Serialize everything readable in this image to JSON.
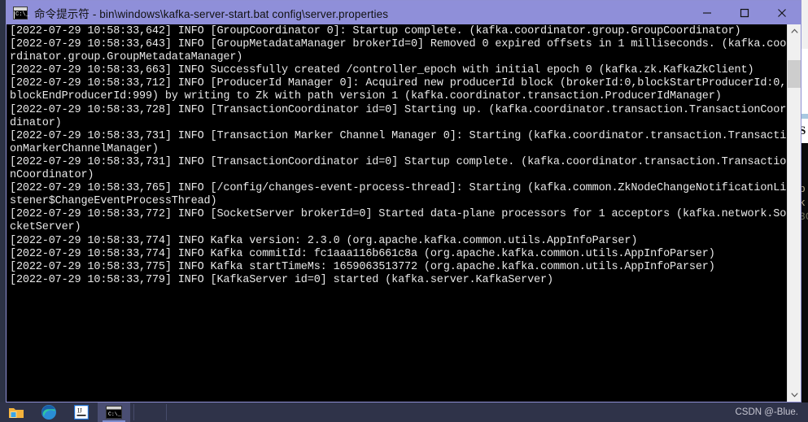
{
  "window": {
    "title": "命令提示符 - bin\\windows\\kafka-server-start.bat  config\\server.properties",
    "icon_name": "command-prompt-icon",
    "titlebar_color": "#8f8fd9",
    "controls": {
      "minimize_label": "Minimize",
      "maximize_label": "Maximize",
      "close_label": "Close"
    }
  },
  "console": {
    "background": "#000000",
    "foreground": "#e8e8e8",
    "lines": [
      "[2022-07-29 10:58:33,642] INFO [GroupCoordinator 0]: Startup complete. (kafka.coordinator.group.GroupCoordinator)",
      "[2022-07-29 10:58:33,643] INFO [GroupMetadataManager brokerId=0] Removed 0 expired offsets in 1 milliseconds. (kafka.coo",
      "rdinator.group.GroupMetadataManager)",
      "[2022-07-29 10:58:33,663] INFO Successfully created /controller_epoch with initial epoch 0 (kafka.zk.KafkaZkClient)",
      "[2022-07-29 10:58:33,712] INFO [ProducerId Manager 0]: Acquired new producerId block (brokerId:0,blockStartProducerId:0,",
      "blockEndProducerId:999) by writing to Zk with path version 1 (kafka.coordinator.transaction.ProducerIdManager)",
      "[2022-07-29 10:58:33,728] INFO [TransactionCoordinator id=0] Starting up. (kafka.coordinator.transaction.TransactionCoor",
      "dinator)",
      "[2022-07-29 10:58:33,731] INFO [Transaction Marker Channel Manager 0]: Starting (kafka.coordinator.transaction.Transacti",
      "onMarkerChannelManager)",
      "[2022-07-29 10:58:33,731] INFO [TransactionCoordinator id=0] Startup complete. (kafka.coordinator.transaction.Transactio",
      "nCoordinator)",
      "[2022-07-29 10:58:33,765] INFO [/config/changes-event-process-thread]: Starting (kafka.common.ZkNodeChangeNotificationLi",
      "stener$ChangeEventProcessThread)",
      "[2022-07-29 10:58:33,772] INFO [SocketServer brokerId=0] Started data-plane processors for 1 acceptors (kafka.network.So",
      "cketServer)",
      "[2022-07-29 10:58:33,774] INFO Kafka version: 2.3.0 (org.apache.kafka.common.utils.AppInfoParser)",
      "[2022-07-29 10:58:33,774] INFO Kafka commitId: fc1aaa116b661c8a (org.apache.kafka.common.utils.AppInfoParser)",
      "[2022-07-29 10:58:33,775] INFO Kafka startTimeMs: 1659063513772 (org.apache.kafka.common.utils.AppInfoParser)",
      "[2022-07-29 10:58:33,779] INFO [KafkaServer id=0] started (kafka.server.KafkaServer)"
    ]
  },
  "scrollbar": {
    "up_arrow_name": "scroll-up-arrow",
    "down_arrow_name": "scroll-down-arrow",
    "thumb_name": "scroll-thumb"
  },
  "taskbar": {
    "background": "#2f3349",
    "items": [
      {
        "name": "file-explorer",
        "label": "File Explorer",
        "active": false
      },
      {
        "name": "microsoft-edge",
        "label": "Microsoft Edge",
        "active": false
      },
      {
        "name": "intellij-idea",
        "label": "IntelliJ IDEA",
        "active": false
      },
      {
        "name": "command-prompt",
        "label": "Command Prompt",
        "active": true
      }
    ],
    "watermark": "CSDN @-Blue."
  },
  "background_window": {
    "snippet_letter": "S",
    "log_fragments": [
      "b",
      "k",
      "3C"
    ]
  }
}
